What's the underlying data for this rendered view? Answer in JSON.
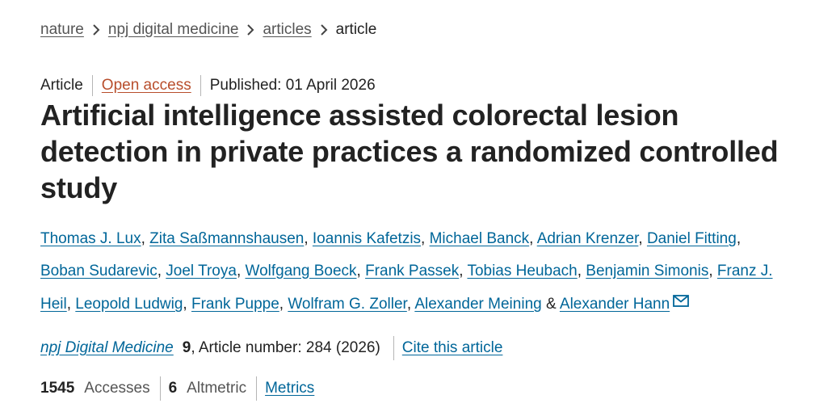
{
  "breadcrumb": {
    "items": [
      "nature",
      "npj digital medicine",
      "articles"
    ],
    "current": "article"
  },
  "meta": {
    "type": "Article",
    "access": "Open access",
    "published": "Published: 01 April 2026"
  },
  "title": "Artificial intelligence assisted colorectal lesion detection in private practices a randomized controlled study",
  "authors": [
    "Thomas J. Lux",
    "Zita Saßmannshausen",
    "Ioannis Kafetzis",
    "Michael Banck",
    "Adrian Krenzer",
    "Daniel Fitting",
    "Boban Sudarevic",
    "Joel Troya",
    "Wolfgang Boeck",
    "Frank Passek",
    "Tobias Heubach",
    "Benjamin Simonis",
    "Franz J. Heil",
    "Leopold Ludwig",
    "Frank Puppe",
    "Wolfram G. Zoller",
    "Alexander Meining",
    "Alexander Hann"
  ],
  "authors_separator": ",",
  "authors_conjunction": "&",
  "corresponding_icon": "mail-icon",
  "journal": {
    "name": "npj Digital Medicine",
    "volume": "9",
    "article_info": ", Article number: 284 (2026)",
    "cite_label": "Cite this article"
  },
  "metrics": {
    "accesses_count": "1545",
    "accesses_label": "Accesses",
    "altmetric_count": "6",
    "altmetric_label": "Altmetric",
    "metrics_link": "Metrics"
  },
  "colors": {
    "link": "#006699",
    "open_access": "#b84e2c",
    "text": "#222222",
    "muted": "#555555"
  }
}
